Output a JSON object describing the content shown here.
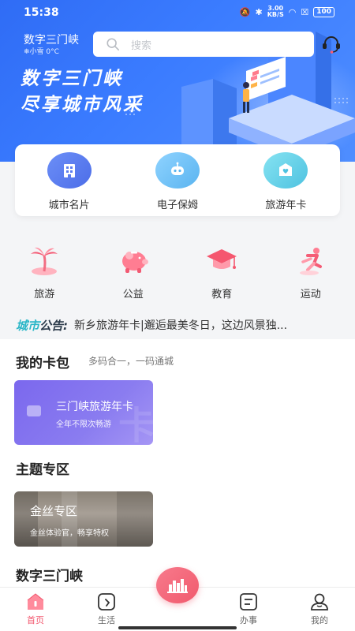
{
  "status": {
    "time": "15:38",
    "net_speed": "3.00",
    "net_unit": "KB/S",
    "battery": "100"
  },
  "header": {
    "city": "数字三门峡",
    "weather": "❄小雪 0°C",
    "search_placeholder": "搜索"
  },
  "banner": {
    "line1": "数字三门峡",
    "line2": "尽享城市风采"
  },
  "quick_actions": [
    {
      "label": "城市名片",
      "icon": "building-icon",
      "color": "#5b7df0"
    },
    {
      "label": "电子保姆",
      "icon": "robot-icon",
      "color": "#5ab4f0"
    },
    {
      "label": "旅游年卡",
      "icon": "card-heart-icon",
      "color": "#4ec2e0"
    }
  ],
  "categories": [
    {
      "label": "旅游",
      "icon": "palm-tree-icon"
    },
    {
      "label": "公益",
      "icon": "piggy-bank-icon"
    },
    {
      "label": "教育",
      "icon": "graduation-cap-icon"
    },
    {
      "label": "运动",
      "icon": "runner-icon"
    }
  ],
  "notice": {
    "tag_a": "城市",
    "tag_b": "公告:",
    "text": "新乡旅游年卡|邂逅最美冬日，这边风景独..."
  },
  "wallet": {
    "title": "我的卡包",
    "subtitle": "多码合一，一码通城",
    "card_title": "三门峡旅游年卡",
    "card_sub": "全年不限次畅游"
  },
  "theme": {
    "title": "主题专区",
    "card_title": "金丝专区",
    "card_sub": "金丝体验官，畅享特权"
  },
  "digital": {
    "title": "数字三门峡"
  },
  "nav": [
    {
      "label": "首页",
      "icon": "home-icon",
      "active": true
    },
    {
      "label": "生活",
      "icon": "life-icon",
      "active": false
    },
    {
      "label": "办事",
      "icon": "service-list-icon",
      "active": false
    },
    {
      "label": "我的",
      "icon": "profile-icon",
      "active": false
    }
  ],
  "colors": {
    "primary": "#2f6cf5",
    "accent": "#f2566d",
    "card_purple": "#7b68ee"
  }
}
